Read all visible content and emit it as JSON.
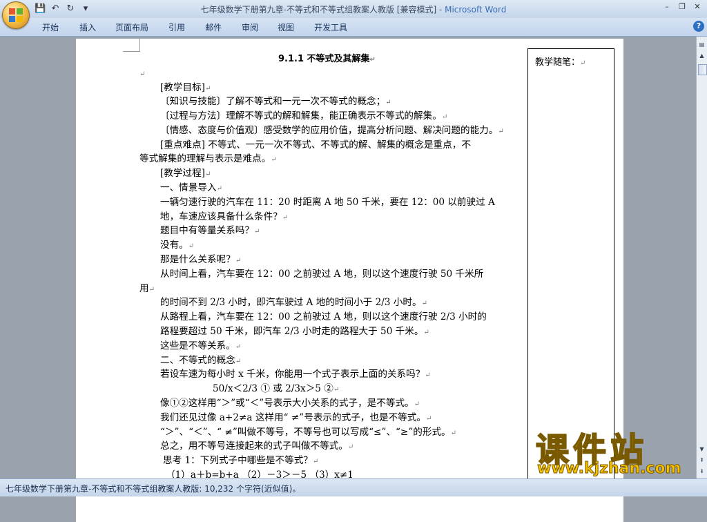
{
  "window": {
    "doc_title": "七年级数学下册第九章-不等式和不等式组教案人教版 [兼容模式] - ",
    "app_name": "Microsoft Word",
    "minimize": "–",
    "restore": "❐",
    "close": "✕"
  },
  "ribbon": {
    "tabs": [
      "开始",
      "插入",
      "页面布局",
      "引用",
      "邮件",
      "审阅",
      "视图",
      "开发工具"
    ],
    "help": "?"
  },
  "document": {
    "title": "9.1.1 不等式及其解集",
    "para_mark": "↵",
    "lines": [
      "[教学目标]",
      "〔知识与技能〕了解不等式和一元一次不等式的概念；",
      "〔过程与方法〕理解不等式的解和解集，能正确表示不等式的解集。",
      "〔情感、态度与价值观〕感受数学的应用价值，提高分析问题、解决问题的能力。",
      "[重点难点] 不等式、一元一次不等式、不等式的解、解集的概念是重点，不",
      "等式解集的理解与表示是难点。",
      "[教学过程]",
      "一、情景导入",
      "一辆匀速行驶的汽车在 11：20 时距离 A 地 50 千米，要在 12：00 以前驶过 A",
      "地，车速应该具备什么条件？",
      "题目中有等量关系吗？",
      "没有。",
      "那是什么关系呢？",
      "从时间上看，汽车要在 12：00 之前驶过 A 地，则以这个速度行驶 50 千米所",
      "用",
      "的时间不到 2/3 小时，即汽车驶过 A 地的时间小于 2/3 小时。",
      "从路程上看，汽车要在 12：00 之前驶过 A 地，则以这个速度行驶 2/3 小时的",
      "路程要超过 50 千米，即汽车 2/3 小时走的路程大于 50 千米。",
      "这些是不等关系。",
      "二、不等式的概念",
      "若设车速为每小时 x 千米，你能用一个式子表示上面的关系吗？",
      "50/x＜2/3 ①    或 2/3x＞5 ②",
      "像①②这样用“＞”或“＜”号表示大小关系的式子，是不等式。",
      "我们还见过像 a+2≠a 这样用“ ≠”号表示的式子，也是不等式。",
      "“＞”、“＜”、“ ≠”叫做不等号，不等号也可以写成“≤”、“≥”的形式。",
      "总之，用不等号连接起来的式子叫做不等式。",
      "思考 1：下列式子中哪些是不等式？",
      "（1）a＋b=b+a  （2）－3＞－5  （3）x≠1"
    ],
    "side_label": "教学随笔："
  },
  "statusbar": {
    "text": "七年级数学下册第九章-不等式和不等式组教案人教版: 10,232 个字符(近似值)。"
  },
  "watermark": {
    "text": "课件站",
    "url": "www.kjzhan.com"
  }
}
